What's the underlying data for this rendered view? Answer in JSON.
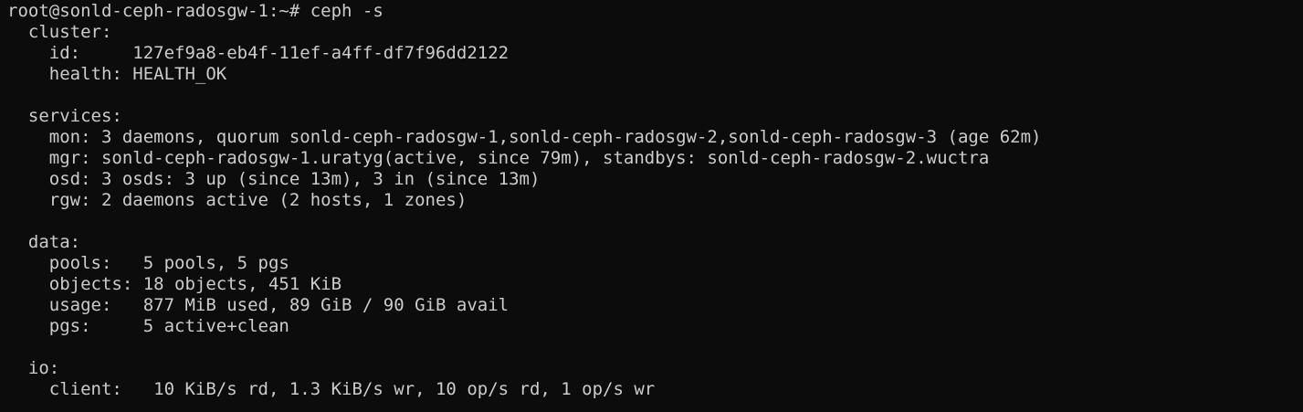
{
  "terminal": {
    "lines": [
      "root@sonld-ceph-radosgw-1:~# ceph -s",
      "  cluster:",
      "    id:     127ef9a8-eb4f-11ef-a4ff-df7f96dd2122",
      "    health: HEALTH_OK",
      "",
      "  services:",
      "    mon: 3 daemons, quorum sonld-ceph-radosgw-1,sonld-ceph-radosgw-2,sonld-ceph-radosgw-3 (age 62m)",
      "    mgr: sonld-ceph-radosgw-1.uratyg(active, since 79m), standbys: sonld-ceph-radosgw-2.wuctra",
      "    osd: 3 osds: 3 up (since 13m), 3 in (since 13m)",
      "    rgw: 2 daemons active (2 hosts, 1 zones)",
      "",
      "  data:",
      "    pools:   5 pools, 5 pgs",
      "    objects: 18 objects, 451 KiB",
      "    usage:   877 MiB used, 89 GiB / 90 GiB avail",
      "    pgs:     5 active+clean",
      "",
      "  io:",
      "    client:   10 KiB/s rd, 1.3 KiB/s wr, 10 op/s rd, 1 op/s wr"
    ]
  }
}
